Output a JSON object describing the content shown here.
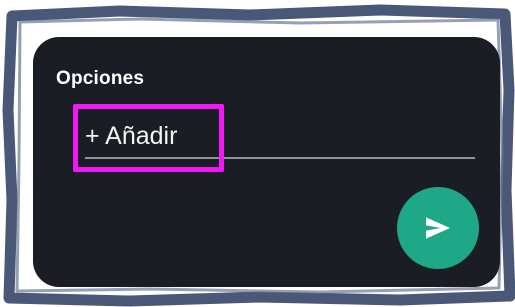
{
  "options_section": {
    "title": "Opciones",
    "add_option_label": "+ Añadir"
  },
  "send_button": {
    "icon": "send-icon",
    "color": "#1fa888"
  },
  "colors": {
    "panel_background": "#1a1d24",
    "highlight": "#f018f4",
    "frame": "#4a5878",
    "underline": "#8e949c"
  }
}
